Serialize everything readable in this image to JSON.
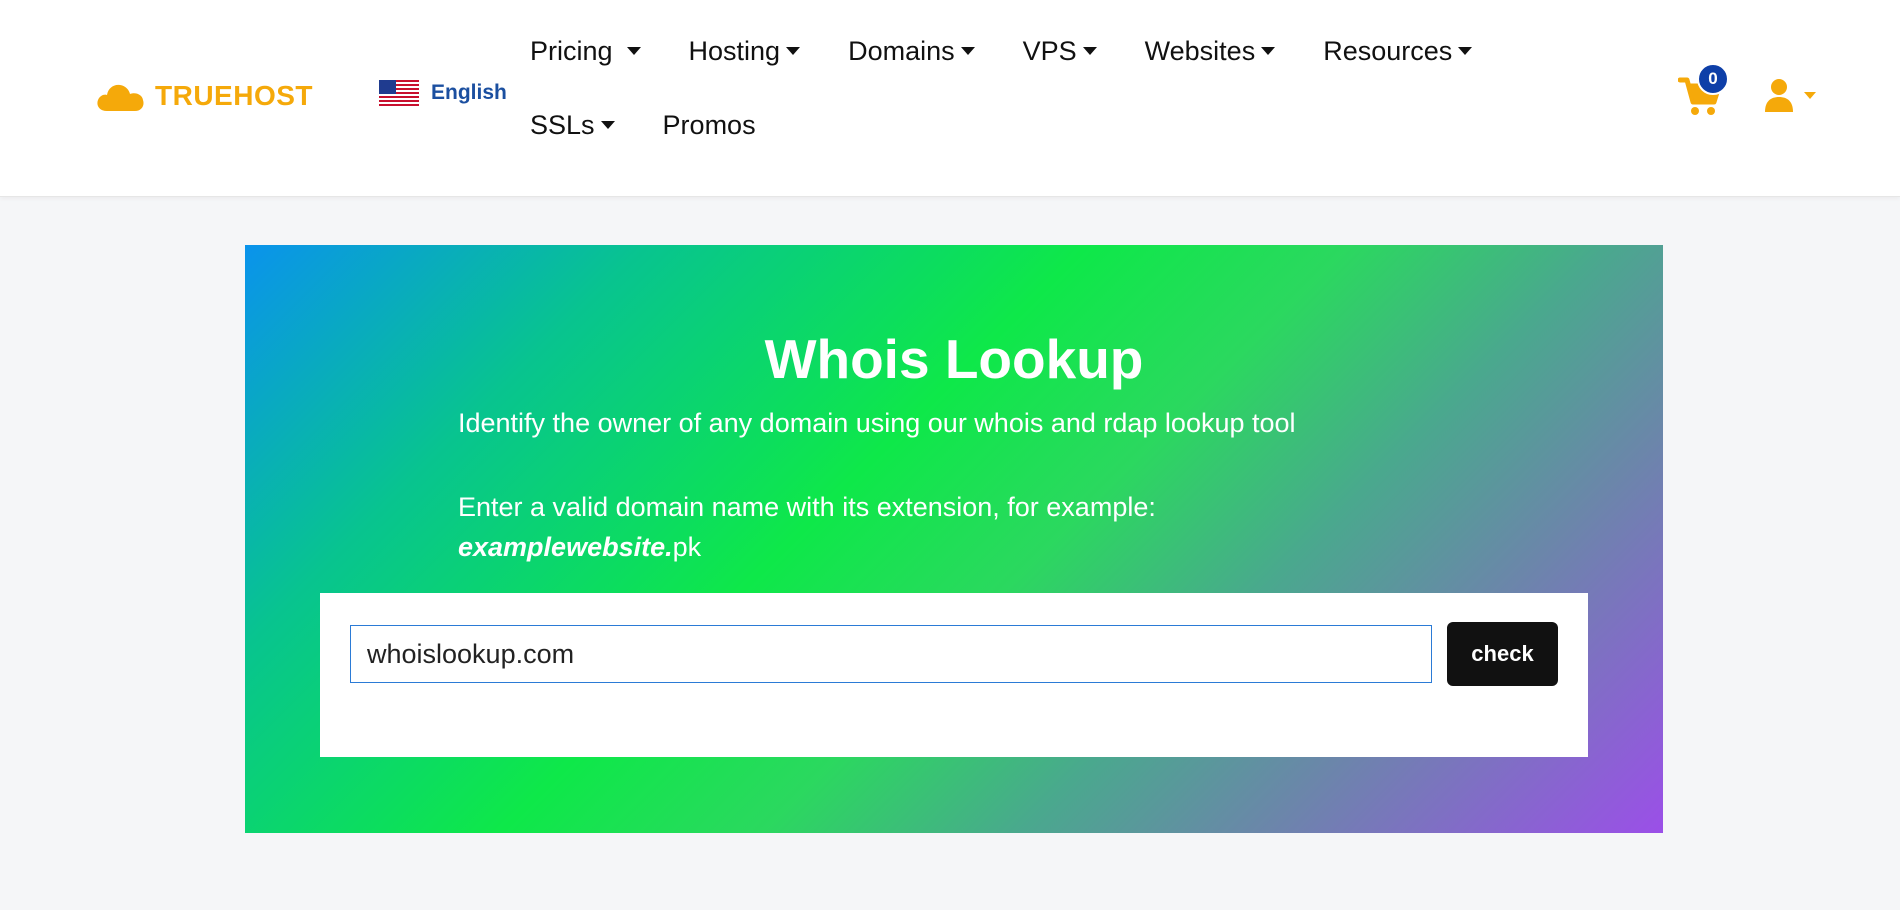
{
  "brand": {
    "name": "TRUEHOST",
    "color": "#f5a90a"
  },
  "language": {
    "label": "English",
    "flag": "us-flag-icon"
  },
  "nav": [
    {
      "label": "Pricing",
      "dropdown": true
    },
    {
      "label": "Hosting",
      "dropdown": true
    },
    {
      "label": "Domains",
      "dropdown": true
    },
    {
      "label": "VPS",
      "dropdown": true
    },
    {
      "label": "Websites",
      "dropdown": true
    },
    {
      "label": "Resources",
      "dropdown": true
    },
    {
      "label": "SSLs",
      "dropdown": true
    },
    {
      "label": "Promos",
      "dropdown": false
    }
  ],
  "cart": {
    "count": "0",
    "icon": "cart-icon"
  },
  "account": {
    "icon": "user-icon"
  },
  "hero": {
    "title": "Whois Lookup",
    "subtitle": "Identify the owner of any domain using our whois and rdap lookup tool",
    "hint": "Enter a valid domain name with its extension, for example:",
    "example_name": "examplewebsite.",
    "example_ext": "pk"
  },
  "search": {
    "value": "whoislookup.com",
    "button_label": "check"
  },
  "colors": {
    "accent": "#f5a90a",
    "link": "#1b4fa0",
    "badge": "#0e3fa8",
    "button": "#111111"
  }
}
